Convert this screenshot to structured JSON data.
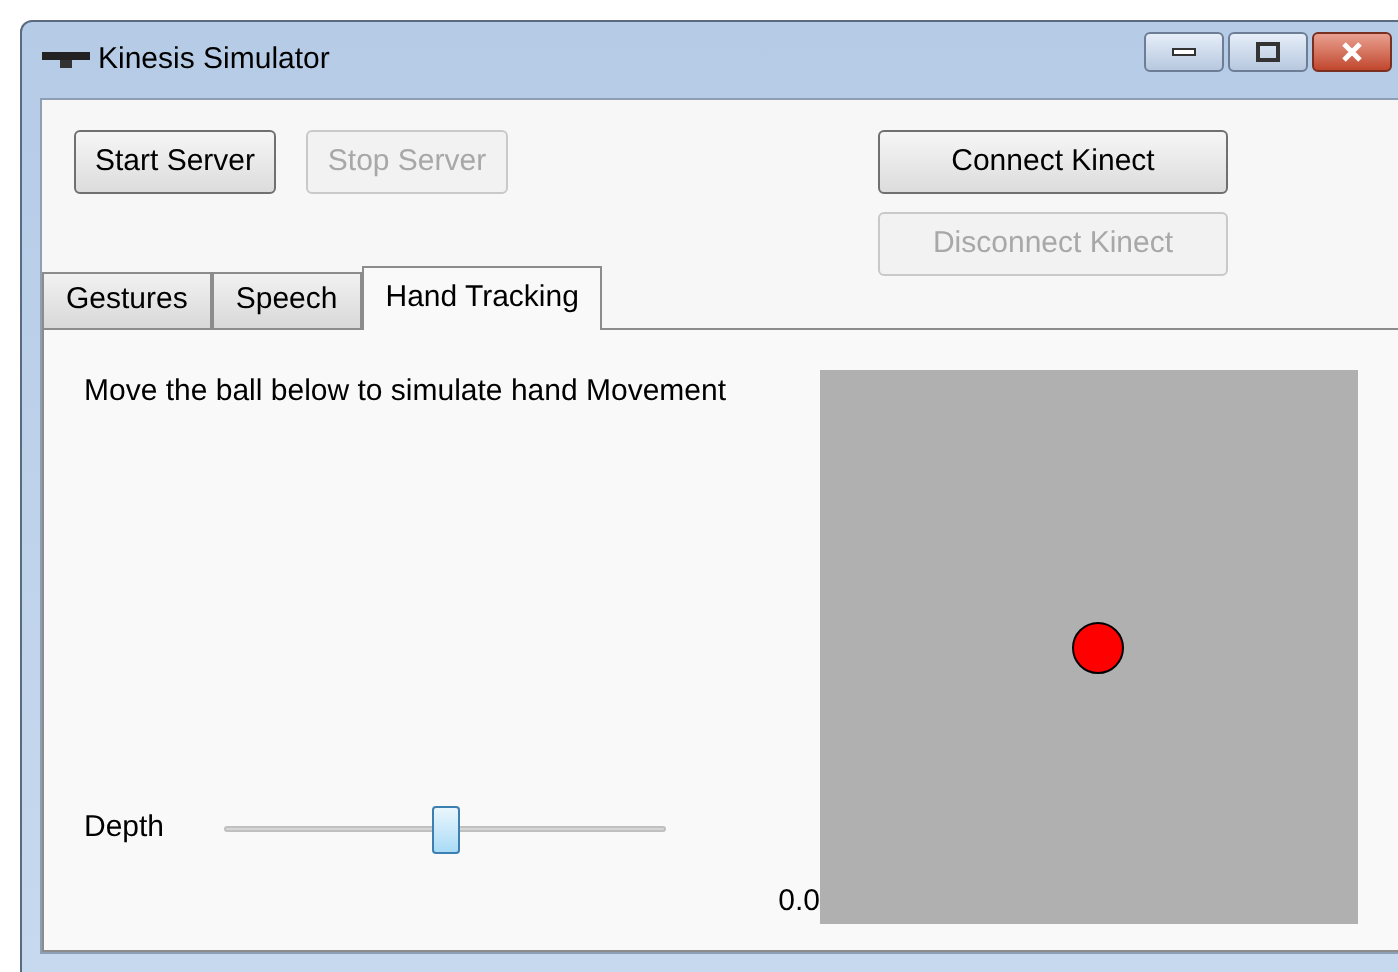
{
  "window": {
    "title": "Kinesis Simulator"
  },
  "server_buttons": [
    {
      "label": "Start Server",
      "disabled": false
    },
    {
      "label": "Stop Server",
      "disabled": true
    }
  ],
  "kinect_buttons": [
    {
      "label": "Connect Kinect",
      "disabled": false
    },
    {
      "label": "Disconnect Kinect",
      "disabled": true
    }
  ],
  "tabs": [
    {
      "label": "Gestures",
      "selected": false
    },
    {
      "label": "Speech",
      "selected": false
    },
    {
      "label": "Hand Tracking",
      "selected": true
    }
  ],
  "hand_tracking": {
    "instruction": "Move the ball below to simulate hand Movement",
    "depth": {
      "label": "Depth",
      "level": 0.5,
      "reading": "0.0"
    }
  }
}
